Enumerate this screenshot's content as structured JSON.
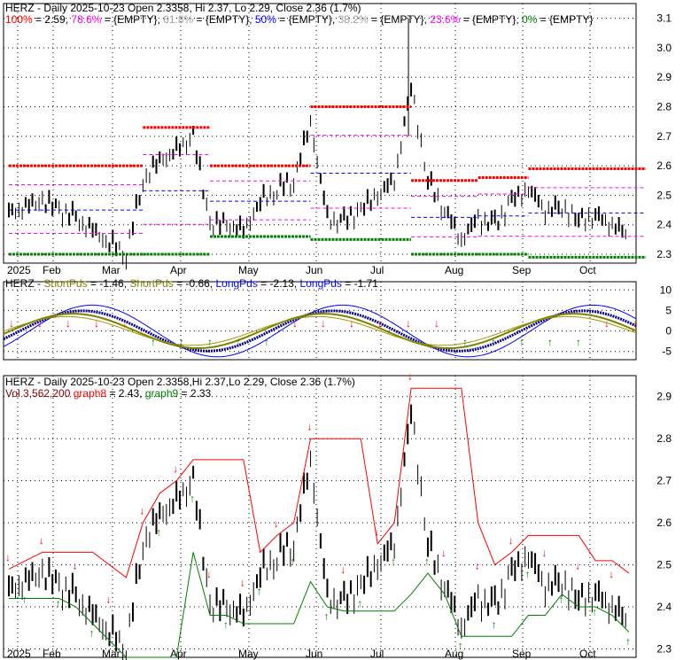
{
  "chart_data": [
    {
      "type": "ohlc",
      "panel": "price",
      "ticker": "HERZ",
      "title": "HERZ - Daily 2025-10-23 Open 2.3358, Hi 2.37, Lo 2.29, Close 2.36 (1.7%)",
      "fib": [
        {
          "label": "100%",
          "value": "2.59",
          "color": "#ff0000"
        },
        {
          "label": "78.6%",
          "value": "{EMPTY}",
          "color": "#ff00ff"
        },
        {
          "label": "61.8%",
          "value": "{EMPTY}",
          "color": "#a0a0a0"
        },
        {
          "label": "50%",
          "value": "{EMPTY}",
          "color": "#0000ff"
        },
        {
          "label": "38.2%",
          "value": "{EMPTY}",
          "color": "#a0a0a0"
        },
        {
          "label": "23.6%",
          "value": "{EMPTY}",
          "color": "#ff00ff"
        },
        {
          "label": "0%",
          "value": "{EMPTY}",
          "color": "#008000"
        }
      ],
      "ylim": [
        2.27,
        3.15
      ],
      "yticks": [
        "2.3",
        "2.4",
        "2.5",
        "2.6",
        "2.7",
        "2.8",
        "2.9",
        "3.0",
        "3.1"
      ],
      "xticks": [
        "2025",
        "Feb",
        "Mar",
        "Apr",
        "May",
        "Jun",
        "Jul",
        "Aug",
        "Sep",
        "Oct"
      ],
      "closes": [
        2.44,
        2.46,
        2.48,
        2.45,
        2.42,
        2.38,
        2.34,
        2.3,
        2.55,
        2.62,
        2.65,
        2.7,
        2.4,
        2.4,
        2.38,
        2.48,
        2.52,
        2.55,
        2.75,
        2.42,
        2.41,
        2.45,
        2.5,
        2.55,
        2.87,
        2.55,
        2.45,
        2.35,
        2.42,
        2.4,
        2.48,
        2.52,
        2.45,
        2.46,
        2.42,
        2.43,
        2.4,
        2.36
      ],
      "highs_spike": {
        "index": 24,
        "value": 3.1
      }
    },
    {
      "type": "line",
      "panel": "oscillator",
      "title_prefix": "HERZ - ",
      "legend": [
        {
          "label": "ShortPds",
          "value": "-1.46",
          "color": "#808000"
        },
        {
          "label": "ShortPds",
          "value": "-0.66",
          "color": "#808000"
        },
        {
          "label": "LongPds",
          "value": "-2.13",
          "color": "#0000ff"
        },
        {
          "label": "LongPds",
          "value": "-1.71",
          "color": "#0000ff"
        }
      ],
      "ylim": [
        -7,
        12
      ],
      "yticks": [
        "10",
        "5",
        "0",
        "-5"
      ]
    },
    {
      "type": "ohlc",
      "panel": "stops",
      "title": "HERZ - Daily 2025-10-23 Open 2.3358,Hi 2.37,Lo 2.29, Close 2.36 (1.7%)",
      "vol": "Vol 3,562,200",
      "legend": [
        {
          "label": "graph8",
          "value": "2.43",
          "color": "#ff0000"
        },
        {
          "label": "graph9",
          "value": "2.33",
          "color": "#008000"
        }
      ],
      "ylim": [
        2.28,
        2.95
      ],
      "yticks": [
        "2.3",
        "2.4",
        "2.5",
        "2.6",
        "2.7",
        "2.8",
        "2.9"
      ]
    }
  ]
}
